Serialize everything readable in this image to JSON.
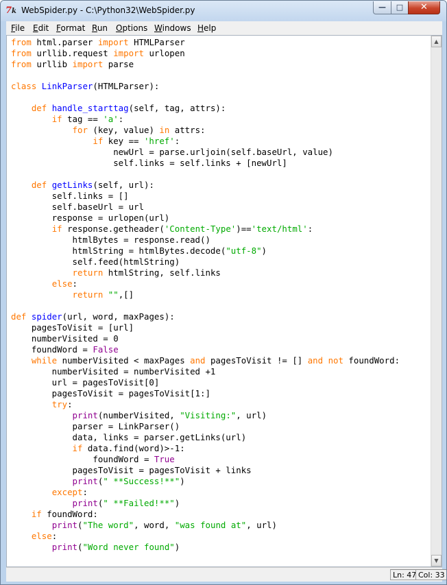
{
  "window": {
    "title": "WebSpider.py - C:\\Python32\\WebSpider.py",
    "icon": "tk-feather-icon",
    "minimize_glyph": "—",
    "maximize_glyph": "□",
    "close_glyph": "✕"
  },
  "menu": [
    {
      "id": "file",
      "accel": "F",
      "rest": "ile"
    },
    {
      "id": "edit",
      "accel": "E",
      "rest": "dit"
    },
    {
      "id": "format",
      "accel": "F",
      "rest": "ormat"
    },
    {
      "id": "run",
      "accel": "R",
      "rest": "un"
    },
    {
      "id": "options",
      "accel": "O",
      "rest": "ptions"
    },
    {
      "id": "windows",
      "accel": "W",
      "rest": "indows"
    },
    {
      "id": "help",
      "accel": "H",
      "rest": "elp"
    }
  ],
  "colors": {
    "keyword": "#ff7700",
    "string": "#00aa00",
    "definition": "#0000ff",
    "builtin": "#900090"
  },
  "editor": {
    "lines": [
      [
        [
          "kw",
          "from"
        ],
        [
          "",
          "html.parser "
        ],
        [
          "kw",
          "import"
        ],
        [
          "",
          "HTMLParser"
        ]
      ],
      [
        [
          "kw",
          "from"
        ],
        [
          "",
          "urllib.request "
        ],
        [
          "kw",
          "import"
        ],
        [
          "",
          "urlopen"
        ]
      ],
      [
        [
          "kw",
          "from"
        ],
        [
          "",
          "urllib "
        ],
        [
          "kw",
          "import"
        ],
        [
          "",
          "parse"
        ]
      ],
      [],
      [
        [
          "kw",
          "class"
        ],
        [
          "def",
          "LinkParser"
        ],
        [
          "",
          "(HTMLParser):"
        ]
      ],
      [],
      [
        [
          "",
          "    "
        ],
        [
          "kw",
          "def"
        ],
        [
          "def",
          "handle_starttag"
        ],
        [
          "",
          "(self, tag, attrs):"
        ]
      ],
      [
        [
          "",
          "        "
        ],
        [
          "kw",
          "if"
        ],
        [
          "",
          " tag == "
        ],
        [
          "str",
          "'a'"
        ],
        [
          "",
          ":"
        ]
      ],
      [
        [
          "",
          "            "
        ],
        [
          "kw",
          "for"
        ],
        [
          "",
          " (key, value) "
        ],
        [
          "kw",
          "in"
        ],
        [
          "",
          " attrs:"
        ]
      ],
      [
        [
          "",
          "                "
        ],
        [
          "kw",
          "if"
        ],
        [
          "",
          " key == "
        ],
        [
          "str",
          "'href'"
        ],
        [
          "",
          ":"
        ]
      ],
      [
        [
          "",
          "                    newUrl = parse.urljoin(self.baseUrl, value)"
        ]
      ],
      [
        [
          "",
          "                    self.links = self.links + [newUrl]"
        ]
      ],
      [],
      [
        [
          "",
          "    "
        ],
        [
          "kw",
          "def"
        ],
        [
          "def",
          "getLinks"
        ],
        [
          "",
          "(self, url):"
        ]
      ],
      [
        [
          "",
          "        self.links = []"
        ]
      ],
      [
        [
          "",
          "        self.baseUrl = url"
        ]
      ],
      [
        [
          "",
          "        response = urlopen(url)"
        ]
      ],
      [
        [
          "",
          "        "
        ],
        [
          "kw",
          "if"
        ],
        [
          "",
          " response.getheader("
        ],
        [
          "str",
          "'Content-Type'"
        ],
        [
          "",
          ")=="
        ],
        [
          "str",
          "'text/html'"
        ],
        [
          "",
          ":"
        ]
      ],
      [
        [
          "",
          "            htmlBytes = response.read()"
        ]
      ],
      [
        [
          "",
          "            htmlString = htmlBytes.decode("
        ],
        [
          "str",
          "\"utf-8\""
        ],
        [
          "",
          ")"
        ]
      ],
      [
        [
          "",
          "            self.feed(htmlString)"
        ]
      ],
      [
        [
          "",
          "            "
        ],
        [
          "kw",
          "return"
        ],
        [
          "",
          " htmlString, self.links"
        ]
      ],
      [
        [
          "",
          "        "
        ],
        [
          "kw",
          "else"
        ],
        [
          "",
          ":"
        ]
      ],
      [
        [
          "",
          "            "
        ],
        [
          "kw",
          "return"
        ],
        [
          "",
          " "
        ],
        [
          "str",
          "\"\""
        ],
        [
          "",
          ",[]"
        ]
      ],
      [],
      [
        [
          "kw",
          "def"
        ],
        [
          "def",
          "spider"
        ],
        [
          "",
          "(url, word, maxPages):"
        ]
      ],
      [
        [
          "",
          "    pagesToVisit = [url]"
        ]
      ],
      [
        [
          "",
          "    numberVisited = 0"
        ]
      ],
      [
        [
          "",
          "    foundWord = "
        ],
        [
          "bi",
          "False"
        ]
      ],
      [
        [
          "",
          "    "
        ],
        [
          "kw",
          "while"
        ],
        [
          "",
          " numberVisited < maxPages "
        ],
        [
          "kw",
          "and"
        ],
        [
          "",
          " pagesToVisit != [] "
        ],
        [
          "kw",
          "and"
        ],
        [
          "",
          " "
        ],
        [
          "kw",
          "not"
        ],
        [
          "",
          " foundWord:"
        ]
      ],
      [
        [
          "",
          "        numberVisited = numberVisited +1"
        ]
      ],
      [
        [
          "",
          "        url = pagesToVisit[0]"
        ]
      ],
      [
        [
          "",
          "        pagesToVisit = pagesToVisit[1:]"
        ]
      ],
      [
        [
          "",
          "        "
        ],
        [
          "kw",
          "try"
        ],
        [
          "",
          ":"
        ]
      ],
      [
        [
          "",
          "            "
        ],
        [
          "bi",
          "print"
        ],
        [
          "",
          "(numberVisited, "
        ],
        [
          "str",
          "\"Visiting:\""
        ],
        [
          "",
          ", url)"
        ]
      ],
      [
        [
          "",
          "            parser = LinkParser()"
        ]
      ],
      [
        [
          "",
          "            data, links = parser.getLinks(url)"
        ]
      ],
      [
        [
          "",
          "            "
        ],
        [
          "kw",
          "if"
        ],
        [
          "",
          " data.find(word)>-1:"
        ]
      ],
      [
        [
          "",
          "                foundWord = "
        ],
        [
          "bi",
          "True"
        ]
      ],
      [
        [
          "",
          "            pagesToVisit = pagesToVisit + links"
        ]
      ],
      [
        [
          "",
          "            "
        ],
        [
          "bi",
          "print"
        ],
        [
          "",
          "("
        ],
        [
          "str",
          "\" **Success!**\""
        ],
        [
          "",
          ")"
        ]
      ],
      [
        [
          "",
          "        "
        ],
        [
          "kw",
          "except"
        ],
        [
          "",
          ":"
        ]
      ],
      [
        [
          "",
          "            "
        ],
        [
          "bi",
          "print"
        ],
        [
          "",
          "("
        ],
        [
          "str",
          "\" **Failed!**\""
        ],
        [
          "",
          ")"
        ]
      ],
      [
        [
          "",
          "    "
        ],
        [
          "kw",
          "if"
        ],
        [
          "",
          " foundWord:"
        ]
      ],
      [
        [
          "",
          "        "
        ],
        [
          "bi",
          "print"
        ],
        [
          "",
          "("
        ],
        [
          "str",
          "\"The word\""
        ],
        [
          "",
          ", word, "
        ],
        [
          "str",
          "\"was found at\""
        ],
        [
          "",
          ", url)"
        ]
      ],
      [
        [
          "",
          "    "
        ],
        [
          "kw",
          "else"
        ],
        [
          "",
          ":"
        ]
      ],
      [
        [
          "",
          "        "
        ],
        [
          "bi",
          "print"
        ],
        [
          "",
          "("
        ],
        [
          "str",
          "\"Word never found\""
        ],
        [
          "",
          ")"
        ]
      ]
    ]
  },
  "scrollbar": {
    "up_glyph": "▲",
    "down_glyph": "▼"
  },
  "status": {
    "line": "Ln: 47",
    "column": "Col: 33"
  }
}
